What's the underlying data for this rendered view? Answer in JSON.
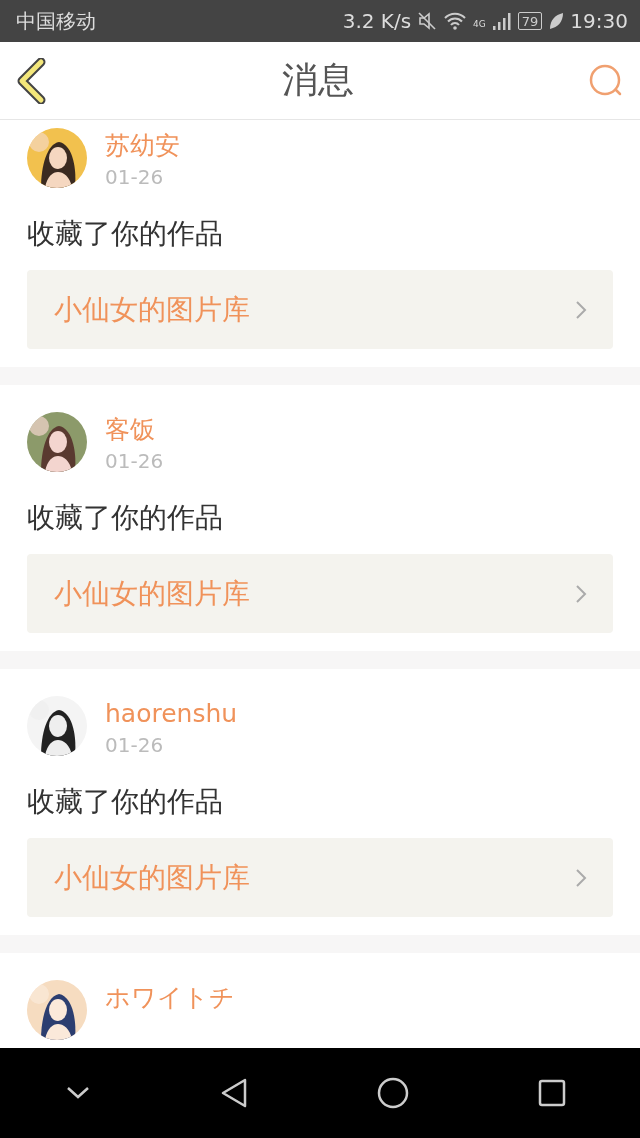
{
  "status_bar": {
    "carrier": "中国移动",
    "speed": "3.2 K/s",
    "network": "4G",
    "battery": "79",
    "time": "19:30"
  },
  "header": {
    "title": "消息"
  },
  "messages": [
    {
      "name": "苏幼安",
      "date": "01-26",
      "text": "收藏了你的作品",
      "link": "小仙女的图片库"
    },
    {
      "name": "客饭",
      "date": "01-26",
      "text": "收藏了你的作品",
      "link": "小仙女的图片库"
    },
    {
      "name": "haorenshu",
      "date": "01-26",
      "text": "收藏了你的作品",
      "link": "小仙女的图片库"
    },
    {
      "name": "ホワイトチ"
    }
  ]
}
